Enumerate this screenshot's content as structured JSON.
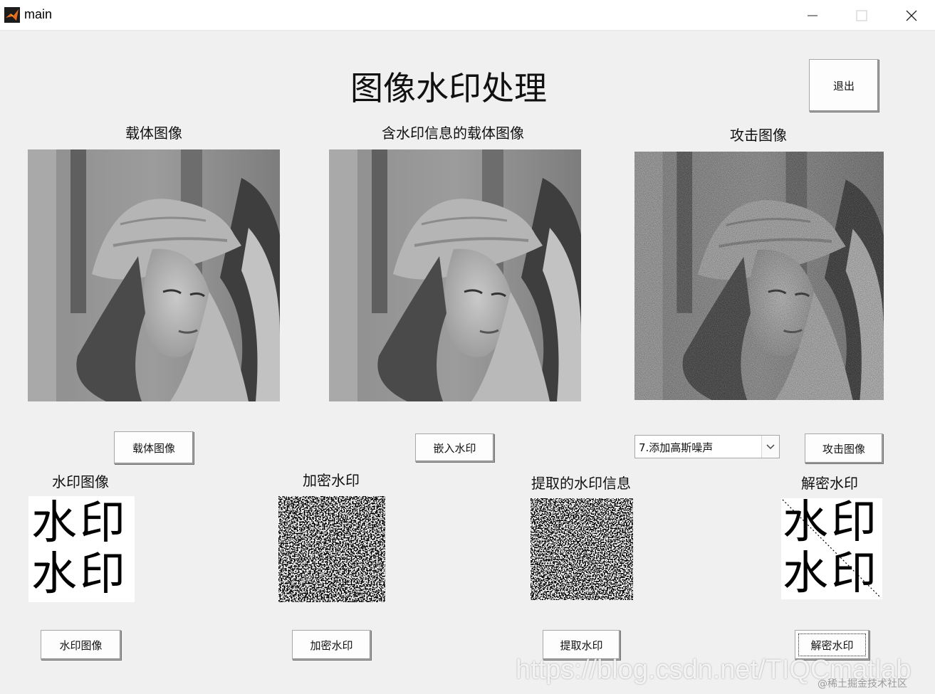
{
  "window": {
    "title": "main"
  },
  "page": {
    "title": "图像水印处理"
  },
  "labels": {
    "carrier": "载体图像",
    "watermarked": "含水印信息的载体图像",
    "attack": "攻击图像",
    "watermark": "水印图像",
    "encrypted": "加密水印",
    "extracted": "提取的水印信息",
    "decrypted": "解密水印"
  },
  "buttons": {
    "exit": "退出",
    "carrier": "载体图像",
    "embed": "嵌入水印",
    "attack": "攻击图像",
    "watermark": "水印图像",
    "encrypt": "加密水印",
    "extract": "提取水印",
    "decrypt": "解密水印"
  },
  "attack_select": {
    "value": "7.添加高斯噪声"
  },
  "watermark_glyphs": {
    "line1": "水印",
    "line2": "水印"
  },
  "overlay": {
    "url": "https://blog.csdn.net/TIQCmatlab",
    "site": "@稀土掘金技术社区"
  },
  "icons": {
    "app": "matlab-logo-icon",
    "minimize": "minimize-icon",
    "maximize": "maximize-icon",
    "close": "close-icon",
    "dropdown": "chevron-down-icon"
  }
}
